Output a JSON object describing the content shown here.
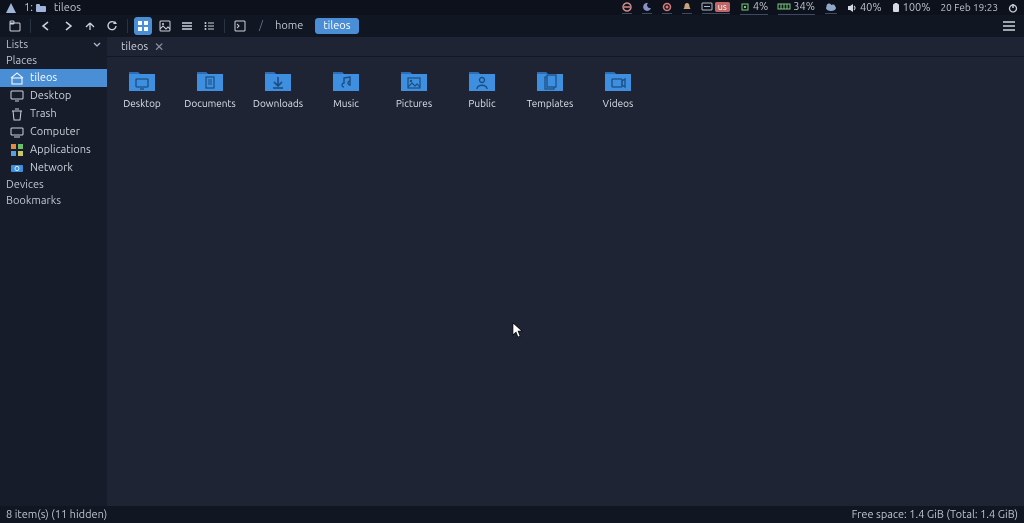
{
  "system": {
    "workspace_index": "1:",
    "window_title": "tileos",
    "tray": {
      "keyboard_layout": "us",
      "cpu_percent": "4%",
      "mem_percent": "34%",
      "other_percent": "40%",
      "battery_percent": "100%",
      "date_time": "20 Feb 19:23"
    }
  },
  "breadcrumb": {
    "sep": "/",
    "home": "home",
    "current": "tileos"
  },
  "sidebar": {
    "lists_label": "Lists",
    "places_label": "Places",
    "devices_label": "Devices",
    "bookmarks_label": "Bookmarks",
    "places": [
      {
        "label": "tileos",
        "icon": "home"
      },
      {
        "label": "Desktop",
        "icon": "desktop"
      },
      {
        "label": "Trash",
        "icon": "trash"
      },
      {
        "label": "Computer",
        "icon": "computer"
      },
      {
        "label": "Applications",
        "icon": "apps"
      },
      {
        "label": "Network",
        "icon": "network"
      }
    ]
  },
  "tab": {
    "label": "tileos"
  },
  "folders": [
    {
      "name": "Desktop",
      "glyph": "desktop"
    },
    {
      "name": "Documents",
      "glyph": "doc"
    },
    {
      "name": "Downloads",
      "glyph": "download"
    },
    {
      "name": "Music",
      "glyph": "music"
    },
    {
      "name": "Pictures",
      "glyph": "picture"
    },
    {
      "name": "Public",
      "glyph": "public"
    },
    {
      "name": "Templates",
      "glyph": "template"
    },
    {
      "name": "Videos",
      "glyph": "video"
    }
  ],
  "status": {
    "left": "8 item(s) (11 hidden)",
    "right": "Free space: 1.4 GiB (Total: 1.4 GiB)"
  },
  "colors": {
    "accent": "#4a8fd6",
    "folder_body": "#3f8fe0",
    "folder_tab": "#2d6db6"
  }
}
